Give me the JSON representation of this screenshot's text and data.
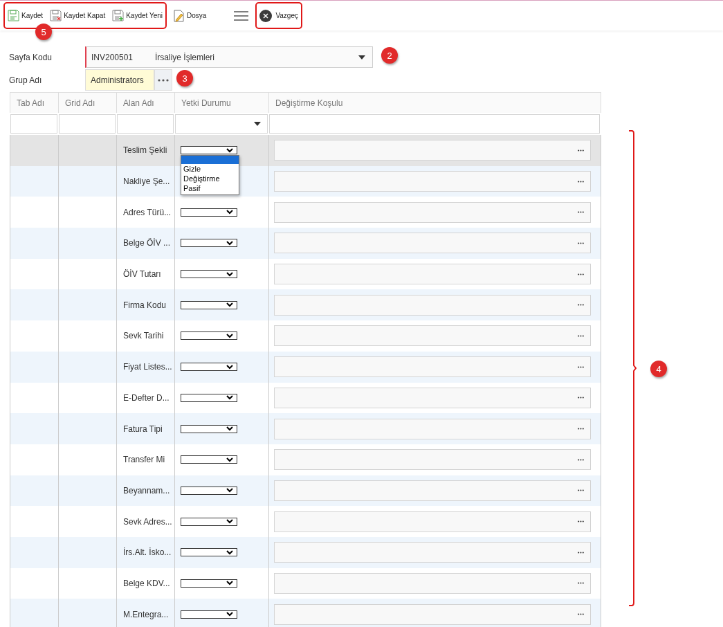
{
  "toolbar": {
    "groups": [
      {
        "framed": true,
        "buttons": [
          {
            "kind": "save",
            "label": "Kaydet"
          },
          {
            "kind": "save-close",
            "label": "Kaydet Kapat"
          },
          {
            "kind": "save-new",
            "label": "Kaydet Yeni"
          }
        ]
      },
      {
        "framed": false,
        "buttons": [
          {
            "kind": "file",
            "label": "Dosya"
          },
          {
            "kind": "menu"
          }
        ]
      },
      {
        "framed": true,
        "buttons": [
          {
            "kind": "cancel",
            "label": "Vazgeç"
          }
        ]
      }
    ]
  },
  "form": {
    "page_code": {
      "label": "Sayfa Kodu",
      "code": "INV200501",
      "name": "İrsaliye İşlemleri"
    },
    "group": {
      "label": "Grup Adı",
      "value": "Administrators"
    }
  },
  "table": {
    "columns": [
      "Tab Adı",
      "Grid Adı",
      "Alan Adı",
      "Yetki Durumu",
      "Değiştirme Koşulu"
    ],
    "rows": [
      {
        "field": "Teslim Şekli",
        "selected": true
      },
      {
        "field": "Nakliye Şe...",
        "selected": false
      },
      {
        "field": "Adres Türü...",
        "selected": false
      },
      {
        "field": "Belge ÖİV ...",
        "selected": false
      },
      {
        "field": "ÖİV Tutarı",
        "selected": false
      },
      {
        "field": "Firma Kodu",
        "selected": false
      },
      {
        "field": "Sevk Tarihi",
        "selected": false
      },
      {
        "field": "Fiyat Listes...",
        "selected": false
      },
      {
        "field": "E-Defter D...",
        "selected": false
      },
      {
        "field": "Fatura Tipi",
        "selected": false
      },
      {
        "field": "Transfer Mi",
        "selected": false
      },
      {
        "field": "Beyannam...",
        "selected": false
      },
      {
        "field": "Sevk Adres...",
        "selected": false
      },
      {
        "field": "İrs.Alt. İsko...",
        "selected": false
      },
      {
        "field": "Belge KDV...",
        "selected": false
      },
      {
        "field": "M.Entegra...",
        "selected": false
      }
    ],
    "open_dropdown": {
      "options": [
        {
          "selected": true
        },
        {
          "label": "Gizle",
          "selected": false
        },
        {
          "label": "Değiştirme",
          "selected": false
        },
        {
          "label": "Pasif",
          "selected": false
        }
      ]
    }
  },
  "annotations": [
    {
      "label": "5"
    },
    {
      "label": "2"
    },
    {
      "label": "3"
    },
    {
      "label": "4"
    }
  ]
}
